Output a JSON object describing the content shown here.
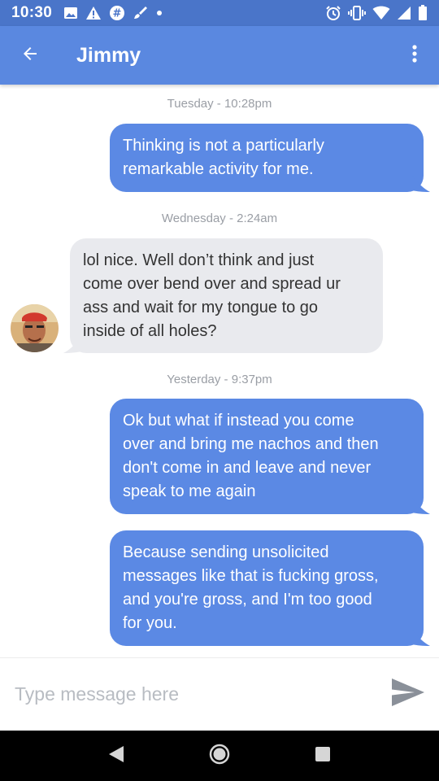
{
  "status_bar": {
    "time": "10:30",
    "icons": [
      "image-icon",
      "warning-icon",
      "slack-icon",
      "brush-icon",
      "dot-icon",
      "alarm-icon",
      "vibrate-icon",
      "wifi-icon",
      "signal-icon",
      "battery-icon"
    ]
  },
  "header": {
    "title": "Jimmy",
    "back_icon": "arrow-back-icon",
    "menu_icon": "more-vert-icon"
  },
  "messages": [
    {
      "type": "timestamp",
      "text": "Tuesday - 10:28pm"
    },
    {
      "type": "outgoing",
      "lines": [
        "Thinking is not a particularly",
        "remarkable activity for me."
      ]
    },
    {
      "type": "timestamp",
      "text": "Wednesday - 2:24am"
    },
    {
      "type": "incoming",
      "lines": [
        "lol nice. Well don’t think and just",
        "come over bend over and spread ur",
        "ass and wait for my tongue to go",
        "inside of all holes?"
      ]
    },
    {
      "type": "timestamp",
      "text": "Yesterday - 9:37pm"
    },
    {
      "type": "outgoing",
      "lines": [
        "Ok but what if instead you come",
        "over and bring me nachos and then",
        "don't come in and leave and never",
        "speak to me again"
      ]
    },
    {
      "type": "outgoing",
      "lines": [
        "Because sending unsolicited",
        "messages like that is fucking gross,",
        "and you're gross, and I'm too good",
        "for you."
      ]
    }
  ],
  "composer": {
    "placeholder": "Type message here",
    "send_icon": "send-icon"
  },
  "colors": {
    "status_bar": "#4a75c9",
    "app_bar": "#5a88e0",
    "outgoing_bubble": "#5b89e4",
    "incoming_bubble": "#e9eaee"
  }
}
